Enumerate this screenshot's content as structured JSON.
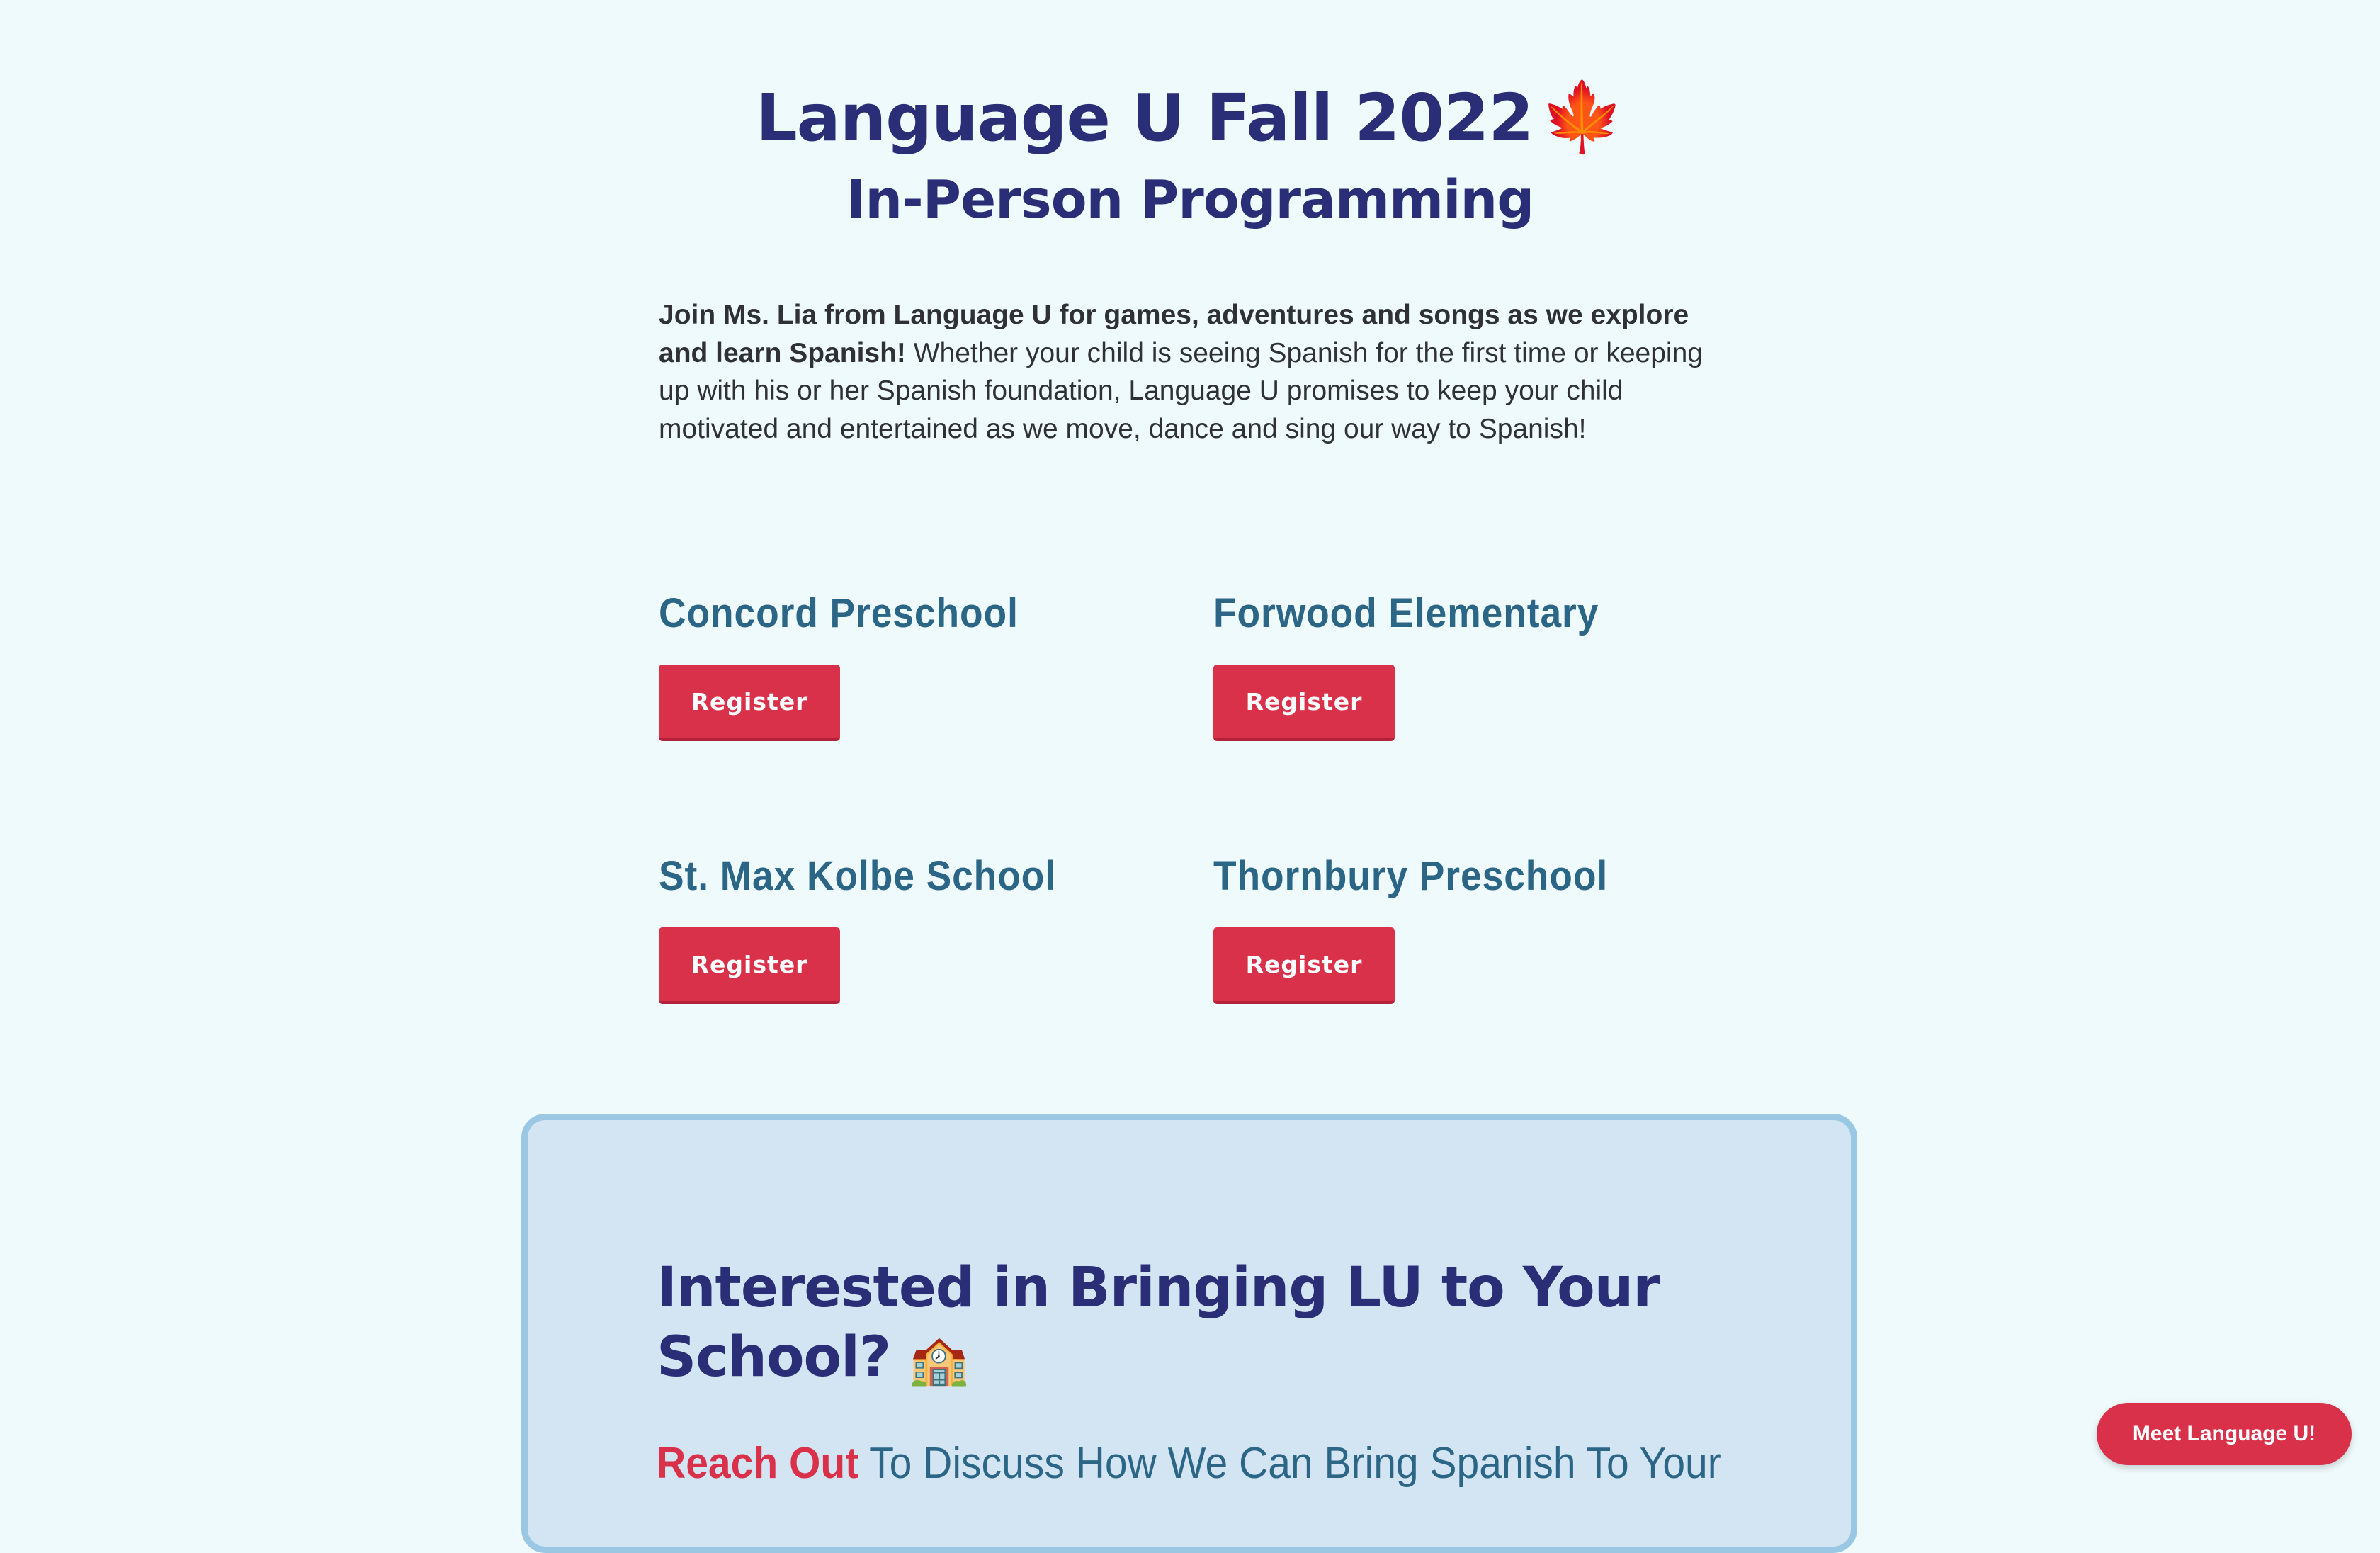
{
  "header": {
    "title": "Language U Fall 2022",
    "title_emoji": "🍁",
    "subtitle": "In-Person Programming"
  },
  "intro": {
    "bold_text": "Join Ms. Lia from Language U for games, adventures and songs as we explore and learn Spanish!",
    "body_text": " Whether your child is seeing Spanish for the first time or keeping up with his or her Spanish foundation, Language U promises to keep your child motivated and entertained as we move, dance and sing our way to Spanish!"
  },
  "schools": [
    {
      "name": "Concord Preschool",
      "button_label": "Register"
    },
    {
      "name": "Forwood Elementary",
      "button_label": "Register"
    },
    {
      "name": "St. Max Kolbe School",
      "button_label": "Register"
    },
    {
      "name": "Thornbury Preschool",
      "button_label": "Register"
    }
  ],
  "card": {
    "title": "Interested in Bringing LU to Your School?",
    "title_emoji": "🏫",
    "accent_text": "Reach Out",
    "sub_text": " To Discuss How We Can Bring Spanish To Your"
  },
  "chat_button": {
    "label": "Meet Language U!"
  },
  "colors": {
    "background": "#effafc",
    "heading": "#2a2e77",
    "school_heading": "#2c6687",
    "button": "#da314a",
    "card_background": "#d3e4f2",
    "card_border": "#9ac8e4"
  }
}
